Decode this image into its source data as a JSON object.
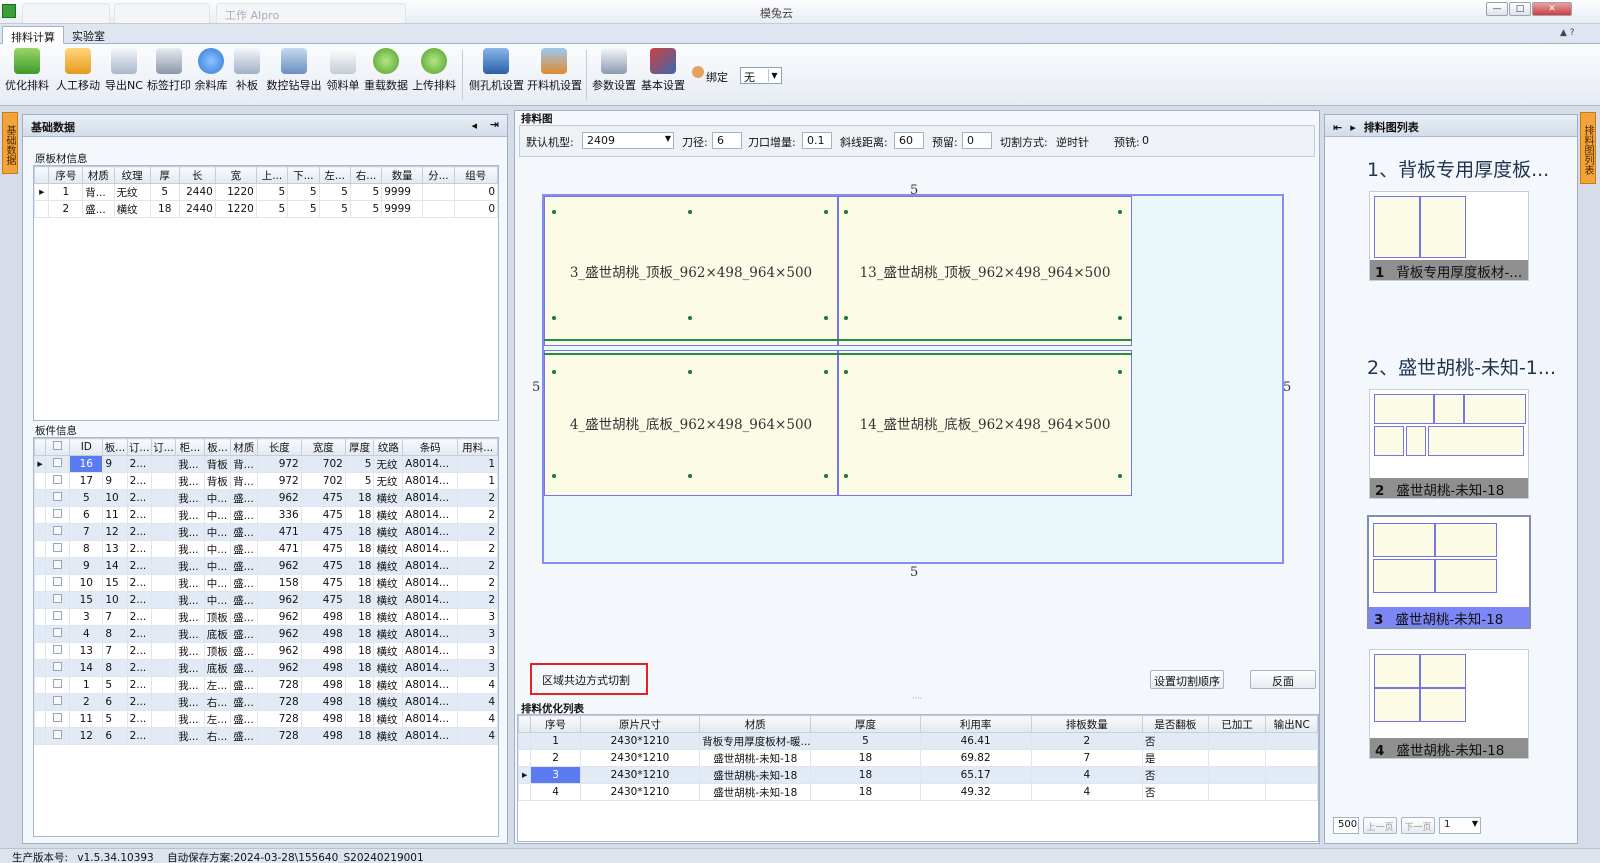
{
  "window": {
    "title": "模兔云",
    "tabs": [
      "",
      "",
      "工作 AIpro"
    ],
    "controls": [
      "—",
      "□",
      "✕"
    ]
  },
  "ribbon": {
    "tabs": [
      "排料计算",
      "实验室"
    ],
    "buttons": [
      "优化排料",
      "人工移动",
      "导出NC",
      "标签打印",
      "余料库",
      "补板",
      "数控钻导出",
      "领料单",
      "重载数据",
      "上传排料",
      "侧孔机设置",
      "开料机设置",
      "参数设置",
      "基本设置"
    ],
    "bind_label": "绑定",
    "bind_value": "无"
  },
  "left": {
    "side_tab": "基础数据",
    "title": "基础数据",
    "raw_section": "原板材信息",
    "raw_columns": [
      "序号",
      "材质",
      "纹理",
      "厚",
      "长",
      "宽",
      "上...",
      "下...",
      "左...",
      "右...",
      "数量",
      "分...",
      "组号"
    ],
    "raw_rows": [
      [
        "1",
        "背...",
        "无纹",
        "5",
        "2440",
        "1220",
        "5",
        "5",
        "5",
        "5",
        "9999",
        "",
        "0"
      ],
      [
        "2",
        "盛...",
        "横纹",
        "18",
        "2440",
        "1220",
        "5",
        "5",
        "5",
        "5",
        "9999",
        "",
        "0"
      ]
    ],
    "parts_section": "板件信息",
    "parts_columns": [
      "",
      "ID",
      "板...",
      "订...",
      "订...",
      "柜...",
      "板...",
      "材质",
      "长度",
      "宽度",
      "厚度",
      "纹路",
      "条码",
      "用料..."
    ],
    "parts_rows": [
      [
        "",
        "16",
        "9",
        "2...",
        "",
        "我...",
        "背板",
        "背...",
        "972",
        "702",
        "5",
        "无纹",
        "A8014...",
        "1"
      ],
      [
        "",
        "17",
        "9",
        "2...",
        "",
        "我...",
        "背板",
        "背...",
        "972",
        "702",
        "5",
        "无纹",
        "A8014...",
        "1"
      ],
      [
        "",
        "5",
        "10",
        "2...",
        "",
        "我...",
        "中...",
        "盛...",
        "962",
        "475",
        "18",
        "横纹",
        "A8014...",
        "2"
      ],
      [
        "",
        "6",
        "11",
        "2...",
        "",
        "我...",
        "中...",
        "盛...",
        "336",
        "475",
        "18",
        "横纹",
        "A8014...",
        "2"
      ],
      [
        "",
        "7",
        "12",
        "2...",
        "",
        "我...",
        "中...",
        "盛...",
        "471",
        "475",
        "18",
        "横纹",
        "A8014...",
        "2"
      ],
      [
        "",
        "8",
        "13",
        "2...",
        "",
        "我...",
        "中...",
        "盛...",
        "471",
        "475",
        "18",
        "横纹",
        "A8014...",
        "2"
      ],
      [
        "",
        "9",
        "14",
        "2...",
        "",
        "我...",
        "中...",
        "盛...",
        "962",
        "475",
        "18",
        "横纹",
        "A8014...",
        "2"
      ],
      [
        "",
        "10",
        "15",
        "2...",
        "",
        "我...",
        "中...",
        "盛...",
        "158",
        "475",
        "18",
        "横纹",
        "A8014...",
        "2"
      ],
      [
        "",
        "15",
        "10",
        "2...",
        "",
        "我...",
        "中...",
        "盛...",
        "962",
        "475",
        "18",
        "横纹",
        "A8014...",
        "2"
      ],
      [
        "",
        "3",
        "7",
        "2...",
        "",
        "我...",
        "顶板",
        "盛...",
        "962",
        "498",
        "18",
        "横纹",
        "A8014...",
        "3"
      ],
      [
        "",
        "4",
        "8",
        "2...",
        "",
        "我...",
        "底板",
        "盛...",
        "962",
        "498",
        "18",
        "横纹",
        "A8014...",
        "3"
      ],
      [
        "",
        "13",
        "7",
        "2...",
        "",
        "我...",
        "顶板",
        "盛...",
        "962",
        "498",
        "18",
        "横纹",
        "A8014...",
        "3"
      ],
      [
        "",
        "14",
        "8",
        "2...",
        "",
        "我...",
        "底板",
        "盛...",
        "962",
        "498",
        "18",
        "横纹",
        "A8014...",
        "3"
      ],
      [
        "",
        "1",
        "5",
        "2...",
        "",
        "我...",
        "左...",
        "盛...",
        "728",
        "498",
        "18",
        "横纹",
        "A8014...",
        "4"
      ],
      [
        "",
        "2",
        "6",
        "2...",
        "",
        "我...",
        "右...",
        "盛...",
        "728",
        "498",
        "18",
        "横纹",
        "A8014...",
        "4"
      ],
      [
        "",
        "11",
        "5",
        "2...",
        "",
        "我...",
        "左...",
        "盛...",
        "728",
        "498",
        "18",
        "横纹",
        "A8014...",
        "4"
      ],
      [
        "",
        "12",
        "6",
        "2...",
        "",
        "我...",
        "右...",
        "盛...",
        "728",
        "498",
        "18",
        "横纹",
        "A8014...",
        "4"
      ]
    ]
  },
  "center": {
    "title": "排料图",
    "machine_label": "默认机型:",
    "machine_value": "2409",
    "knife_label": "刀径:",
    "knife_value": "6",
    "increment_label": "刀口增量:",
    "increment_value": "0.1",
    "slant_label": "斜线距离:",
    "slant_value": "60",
    "reserve_label": "预留:",
    "reserve_value": "0",
    "cut_mode_label": "切割方式:",
    "cut_mode_value": "逆时针",
    "pre_mill_label": "预铣:",
    "pre_mill_value": "0",
    "margins": {
      "top": "5",
      "bottom": "5",
      "left": "5",
      "right": "5"
    },
    "parts": [
      "3_盛世胡桃_顶板_962×498_964×500",
      "13_盛世胡桃_顶板_962×498_964×500",
      "4_盛世胡桃_底板_962×498_964×500",
      "14_盛世胡桃_底板_962×498_964×500"
    ],
    "region_cut": "区域共边方式切割",
    "btn_order": "设置切割顺序",
    "btn_reverse": "反面",
    "list_title": "排料优化列表",
    "list_columns": [
      "",
      "序号",
      "原片尺寸",
      "材质",
      "厚度",
      "利用率",
      "排板数量",
      "是否翻板",
      "已加工",
      "输出NC"
    ],
    "list_rows": [
      [
        "",
        "1",
        "2430*1210",
        "背板专用厚度板材-暖...",
        "5",
        "46.41",
        "2",
        "否",
        "",
        ""
      ],
      [
        "",
        "2",
        "2430*1210",
        "盛世胡桃-未知-18",
        "18",
        "69.82",
        "7",
        "是",
        "",
        ""
      ],
      [
        "▸",
        "3",
        "2430*1210",
        "盛世胡桃-未知-18",
        "18",
        "65.17",
        "4",
        "否",
        "",
        ""
      ],
      [
        "",
        "4",
        "2430*1210",
        "盛世胡桃-未知-18",
        "18",
        "49.32",
        "4",
        "否",
        "",
        ""
      ]
    ]
  },
  "right": {
    "side_tab": "排料图列表",
    "title": "排料图列表",
    "heading1": "1、背板专用厚度板...",
    "heading2": "2、盛世胡桃-未知-1...",
    "thumbs": [
      {
        "num": "1",
        "label": "背板专用厚度板材-..."
      },
      {
        "num": "2",
        "label": "盛世胡桃-未知-18"
      },
      {
        "num": "3",
        "label": "盛世胡桃-未知-18"
      },
      {
        "num": "4",
        "label": "盛世胡桃-未知-18"
      }
    ],
    "page_size": "500",
    "prev": "上一页",
    "next": "下一页",
    "page": "1"
  },
  "status": {
    "version_label": "生产版本号:",
    "version": "v1.5.34.10393",
    "autosave": "自动保存方案:2024-03-28\\155640_S20240219001"
  },
  "colors": {
    "sheet_bg": "#eaf8fb",
    "part_bg": "#fbfbe6",
    "selection": "#5b7cf0",
    "orange_tab": "#f2a33a"
  }
}
